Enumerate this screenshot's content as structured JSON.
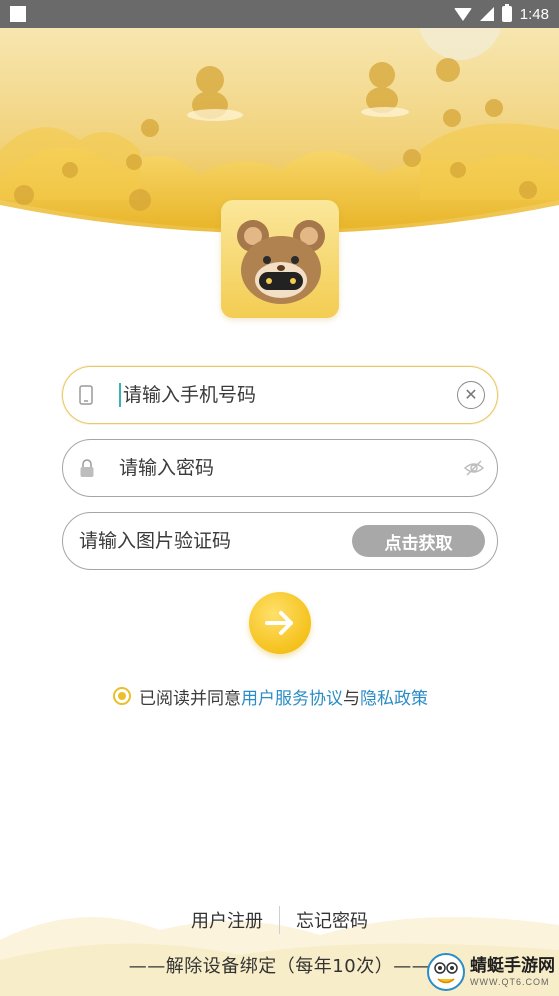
{
  "status_bar": {
    "time": "1:48",
    "icons": [
      "wifi-icon",
      "signal-icon",
      "battery-charging-icon"
    ]
  },
  "colors": {
    "accent_gold": "#f5c21c",
    "link_blue": "#2a8dc6",
    "field_border": "#a5a5a5",
    "active_border": "#e9c86a",
    "button_gray": "#a8a8a8"
  },
  "login": {
    "phone_placeholder": "请输入手机号码",
    "phone_value": "",
    "password_placeholder": "请输入密码",
    "password_value": "",
    "captcha_placeholder": "请输入图片验证码",
    "captcha_value": "",
    "captcha_button": "点击获取"
  },
  "agreement": {
    "checked": true,
    "prefix": "已阅读并同意",
    "terms_link": "用户服务协议",
    "conjunction": "与",
    "privacy_link": "隐私政策"
  },
  "footer": {
    "register": "用户注册",
    "forgot_password": "忘记密码",
    "unbind_device": "——解除设备绑定（每年10次）——"
  },
  "watermark": {
    "name": "蜻蜓手游网",
    "url": "WWW.QT6.COM"
  }
}
